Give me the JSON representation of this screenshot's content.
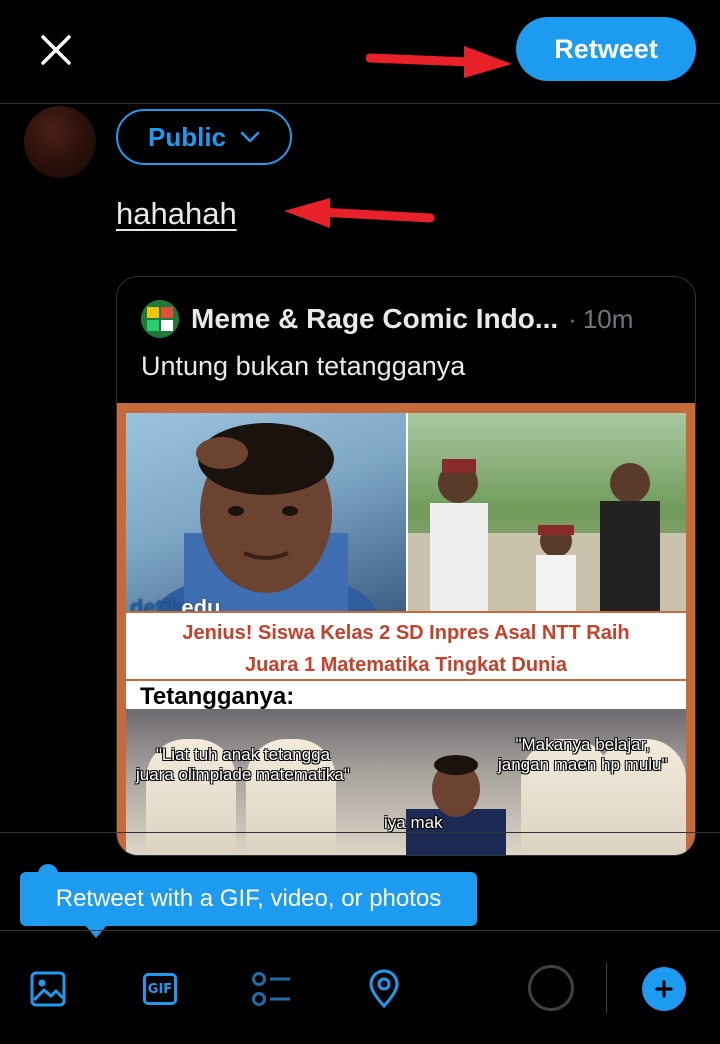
{
  "header": {
    "close_icon": "close-icon",
    "retweet_label": "Retweet"
  },
  "composer": {
    "audience_label": "Public",
    "text": "hahahah"
  },
  "quote": {
    "author_name": "Meme & Rage Comic Indo...",
    "separator": "·",
    "time": "10m",
    "text": "Untung bukan tetangganya",
    "image": {
      "brand": "detikedu",
      "brand_prefix": "detik",
      "brand_suffix": "edu",
      "headline_line1": "Jenius! Siswa Kelas 2 SD Inpres Asal NTT Raih",
      "headline_line2": "Juara 1 Matematika Tingkat Dunia",
      "section_label": "Tetangganya:",
      "caption_left_line1": "\"Liat tuh anak tetangga",
      "caption_left_line2": "juara olimpiade matematika\"",
      "caption_right_line1": "\"Makanya belajar,",
      "caption_right_line2": "jangan maen hp mulu\"",
      "caption_bottom": "iya mak"
    }
  },
  "tooltip": {
    "text": "Retweet with a GIF, video, or photos"
  },
  "toolbar": {
    "gif_label": "GIF",
    "icons": [
      "image-icon",
      "gif-icon",
      "poll-icon",
      "location-icon",
      "character-count-ring",
      "add-thread-icon"
    ]
  },
  "colors": {
    "accent": "#1d9bf0",
    "background": "#000000",
    "annotation_arrow": "#e8202a"
  }
}
